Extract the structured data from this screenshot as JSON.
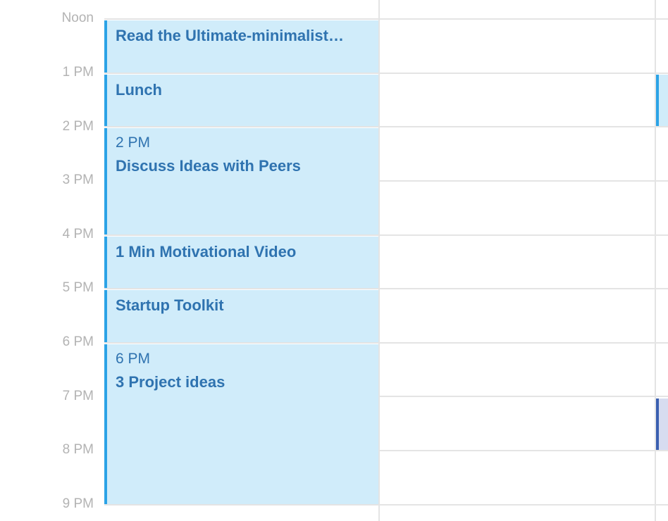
{
  "time_labels": [
    "Noon",
    "1 PM",
    "2 PM",
    "3 PM",
    "4 PM",
    "5 PM",
    "6 PM",
    "7 PM",
    "8 PM",
    "9 PM"
  ],
  "events": [
    {
      "time": "",
      "title": "Read the Ultimate-minimalist…"
    },
    {
      "time": "",
      "title": "Lunch"
    },
    {
      "time": "2 PM",
      "title": "Discuss Ideas with Peers"
    },
    {
      "time": "",
      "title": "1 Min Motivational Video"
    },
    {
      "time": "",
      "title": "Startup Toolkit"
    },
    {
      "time": "6 PM",
      "title": "3 Project ideas"
    }
  ],
  "colors": {
    "event_bg": "#d0ecfa",
    "event_accent": "#2ba3e6",
    "event_text": "#2f73b0",
    "alt_event_bg": "#d7dcf0",
    "alt_event_accent": "#3a5fb0",
    "grid_line": "#e4e4e4",
    "time_label": "#b3b3b3"
  }
}
